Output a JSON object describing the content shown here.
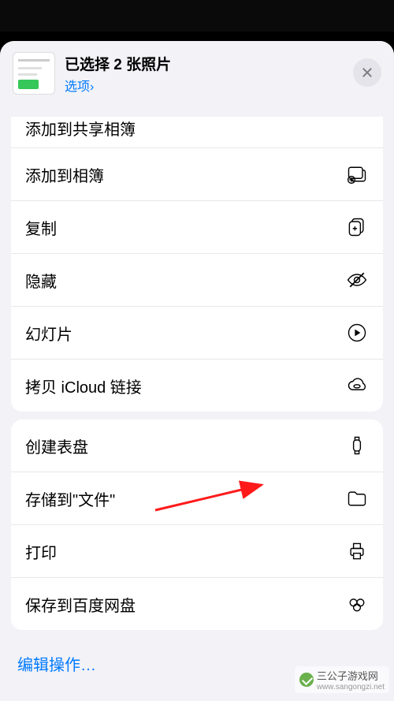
{
  "header": {
    "title": "已选择 2 张照片",
    "options_label": "选项",
    "options_chevron": "›"
  },
  "partial_top_row": {
    "label": "添加到共享相簿"
  },
  "group1": [
    {
      "key": "add-to-album",
      "label": "添加到相簿",
      "icon": "albums-add-icon"
    },
    {
      "key": "copy",
      "label": "复制",
      "icon": "copy-icon"
    },
    {
      "key": "hide",
      "label": "隐藏",
      "icon": "eye-slash-icon"
    },
    {
      "key": "slideshow",
      "label": "幻灯片",
      "icon": "play-circle-icon"
    },
    {
      "key": "icloud-link",
      "label": "拷贝 iCloud 链接",
      "icon": "cloud-link-icon"
    }
  ],
  "group2": [
    {
      "key": "create-watchface",
      "label": "创建表盘",
      "icon": "watch-icon"
    },
    {
      "key": "save-to-files",
      "label": "存储到\"文件\"",
      "icon": "folder-icon"
    },
    {
      "key": "print",
      "label": "打印",
      "icon": "printer-icon"
    },
    {
      "key": "save-baidu",
      "label": "保存到百度网盘",
      "icon": "baidu-cloud-icon"
    }
  ],
  "edit_actions_label": "编辑操作…",
  "watermark": {
    "text": "三公子游戏网",
    "url": "www.sangongzi.net"
  }
}
